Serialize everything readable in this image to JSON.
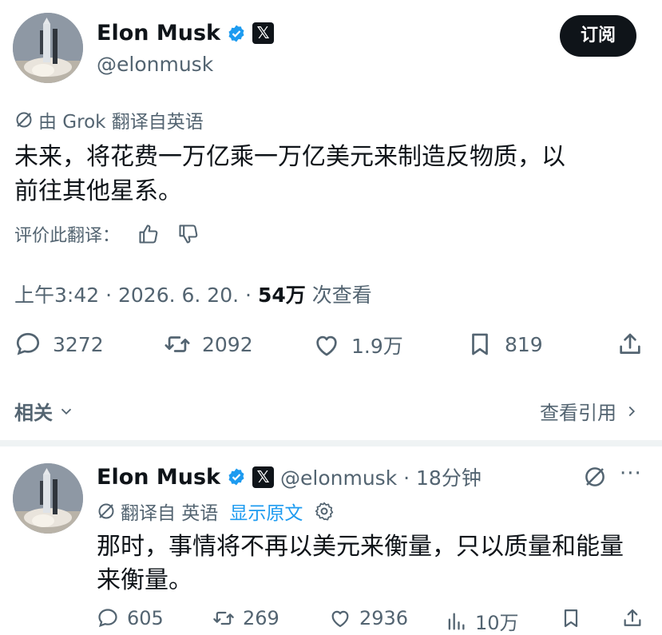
{
  "post": {
    "author_name": "Elon Musk",
    "author_handle": "@elonmusk",
    "subscribe_label": "订阅",
    "translation_label": "由 Grok 翻译自英语",
    "text_line1": "未来，将花费一万亿乘一万亿美元来制造反物质，以",
    "text_line2": "前往其他星系。",
    "rate_translation_label": "评价此翻译：",
    "time": "上午3:42 · 2026. 6. 20. ·",
    "views_count": "54万",
    "views_label": "次查看",
    "replies": "3272",
    "reposts": "2092",
    "likes": "1.9万",
    "bookmarks": "819"
  },
  "related": {
    "label": "相关",
    "quote_label": "查看引用"
  },
  "reply": {
    "author_name": "Elon Musk",
    "author_handle_time": "@elonmusk · 18分钟",
    "translation_label": "翻译自 英语",
    "show_original": "显示原文",
    "text_line1": "那时，事情将不再以美元来衡量，只以质量和能量",
    "text_line2": "来衡量。",
    "replies": "605",
    "reposts": "269",
    "likes": "2936",
    "views": "10万"
  },
  "colors": {
    "verified": "#1d9bf0",
    "text_primary": "#0f1419",
    "text_secondary": "#536471",
    "link": "#1d9bf0"
  },
  "icons": [
    "verified-icon",
    "x-logo-icon",
    "grok-icon",
    "thumbs-up-icon",
    "thumbs-down-icon",
    "reply-icon",
    "repost-icon",
    "like-icon",
    "bookmark-icon",
    "share-icon",
    "chevron-down-icon",
    "chevron-right-icon",
    "settings-icon",
    "views-icon",
    "more-icon"
  ]
}
